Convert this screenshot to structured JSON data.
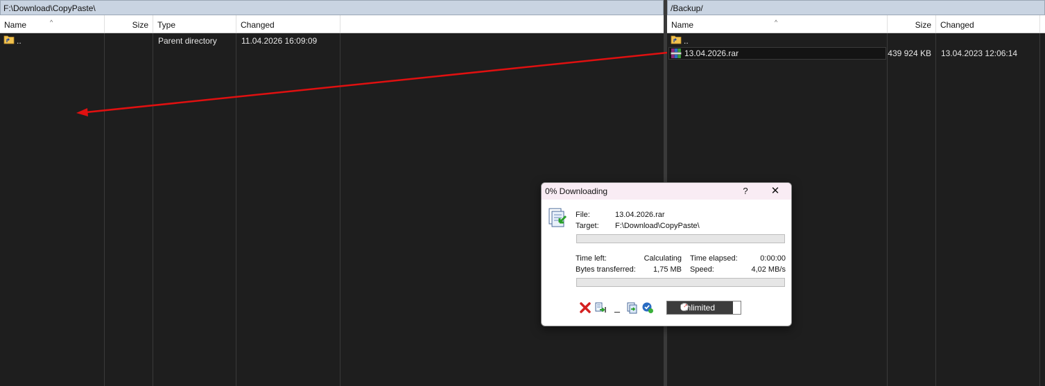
{
  "left_panel": {
    "path": "F:\\Download\\CopyPaste\\",
    "columns": {
      "name": "Name",
      "size": "Size",
      "type": "Type",
      "changed": "Changed"
    },
    "rows": [
      {
        "name": "..",
        "size": "",
        "type": "Parent directory",
        "changed": "11.04.2026  16:09:09"
      }
    ]
  },
  "right_panel": {
    "path": "/Backup/",
    "columns": {
      "name": "Name",
      "size": "Size",
      "changed": "Changed"
    },
    "rows": [
      {
        "name": "..",
        "size": "",
        "changed": ""
      },
      {
        "name": "13.04.2026.rar",
        "size": "439 924 KB",
        "changed": "13.04.2023 12:06:14"
      }
    ]
  },
  "dialog": {
    "title": "0% Downloading",
    "help": "?",
    "close": "✕",
    "file_label": "File:",
    "file_value": "13.04.2026.rar",
    "target_label": "Target:",
    "target_value": "F:\\Download\\CopyPaste\\",
    "time_left_label": "Time left:",
    "time_left_value": "Calculating",
    "time_elapsed_label": "Time elapsed:",
    "time_elapsed_value": "0:00:00",
    "bytes_label": "Bytes transferred:",
    "bytes_value": "1,75 MB",
    "speed_label": "Speed:",
    "speed_value": "4,02 MB/s",
    "file_progress": 0,
    "total_progress": 0,
    "speed_limit": "Unlimited",
    "minimize_glyph": "_"
  },
  "colors": {
    "arrow": "#e01010",
    "path_bar": "#c9d4e2",
    "dialog_title": "#f9ecf4",
    "progress_fill": "#06b025"
  },
  "icons": [
    "parent-folder-icon",
    "rar-archive-icon",
    "transfer-icon",
    "cancel-icon",
    "move-to-queue-icon",
    "minimize-icon",
    "background-icon",
    "post-action-icon",
    "speed-gauge-icon"
  ]
}
